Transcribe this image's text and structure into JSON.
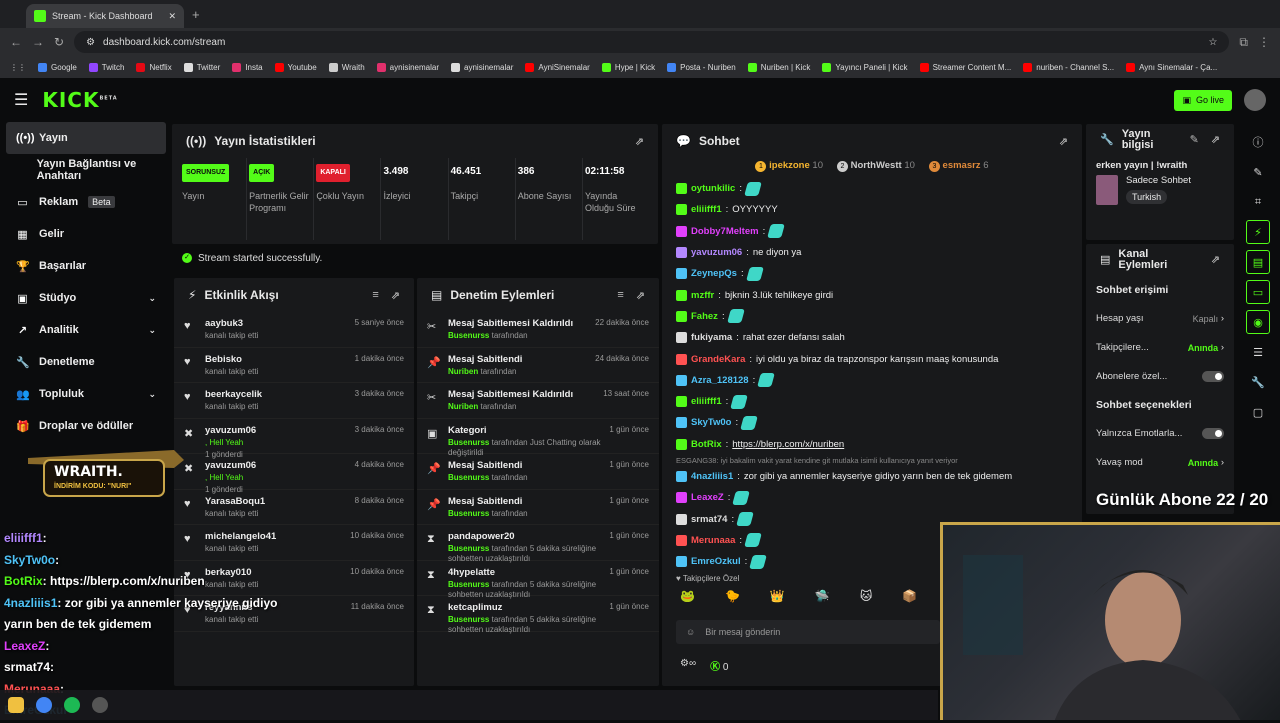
{
  "browser": {
    "tab_title": "Stream - Kick Dashboard",
    "url": "dashboard.kick.com/stream",
    "bookmarks": [
      {
        "label": "Google",
        "color": "#4285f4"
      },
      {
        "label": "Twitch",
        "color": "#9146ff"
      },
      {
        "label": "Netflix",
        "color": "#e50914"
      },
      {
        "label": "Twitter",
        "color": "#dddddd"
      },
      {
        "label": "Insta",
        "color": "#e1306c"
      },
      {
        "label": "Youtube",
        "color": "#ff0000"
      },
      {
        "label": "Wraith",
        "color": "#cccccc"
      },
      {
        "label": "aynisinemalar",
        "color": "#e1306c"
      },
      {
        "label": "aynisinemalar",
        "color": "#dddddd"
      },
      {
        "label": "AyniSinemalar",
        "color": "#ff0000"
      },
      {
        "label": "Hype | Kick",
        "color": "#53fc18"
      },
      {
        "label": "Posta - Nuriben",
        "color": "#4285f4"
      },
      {
        "label": "Nuriben | Kick",
        "color": "#53fc18"
      },
      {
        "label": "Yayıncı Paneli | Kick",
        "color": "#53fc18"
      },
      {
        "label": "Streamer Content M...",
        "color": "#ff0000"
      },
      {
        "label": "nuriben - Channel S...",
        "color": "#ff0000"
      },
      {
        "label": "Aynı Sinemalar - Ça...",
        "color": "#ff0000"
      }
    ]
  },
  "header": {
    "logo": "KICK",
    "logo_sup": "BETA",
    "go_live": "Go live"
  },
  "sidebar": [
    {
      "label": "Yayın",
      "icon": "((•))",
      "active": true
    },
    {
      "label": "Yayın Bağlantısı ve Anahtarı",
      "icon": ""
    },
    {
      "label": "Reklam",
      "icon": "▭",
      "badge": "Beta"
    },
    {
      "label": "Gelir",
      "icon": "▦"
    },
    {
      "label": "Başarılar",
      "icon": "🏆"
    },
    {
      "label": "Stüdyo",
      "icon": "▣",
      "chev": "⌄"
    },
    {
      "label": "Analitik",
      "icon": "↗",
      "chev": "⌄"
    },
    {
      "label": "Denetleme",
      "icon": "🔧"
    },
    {
      "label": "Topluluk",
      "icon": "👥",
      "chev": "⌄"
    },
    {
      "label": "Droplar ve ödüller",
      "icon": "🎁"
    }
  ],
  "stats": {
    "title": "Yayın İstatistikleri",
    "cols": [
      {
        "pill": "SORUNSUZ",
        "pill_color": "#53fc18",
        "label": "Yayın"
      },
      {
        "pill": "AÇIK",
        "pill_color": "#53fc18",
        "label": "Partnerlik Gelir Programı"
      },
      {
        "pill": "KAPALI",
        "pill_color": "#e0202e",
        "label": "Çoklu Yayın"
      },
      {
        "num": "3.498",
        "label": "İzleyici"
      },
      {
        "num": "46.451",
        "label": "Takipçi"
      },
      {
        "num": "386",
        "label": "Abone Sayısı"
      },
      {
        "num": "02:11:58",
        "label": "Yayında Olduğu Süre"
      }
    ],
    "ok": "Stream started successfully."
  },
  "activity": {
    "title": "Etkinlik Akışı",
    "rows": [
      {
        "icon": "♥",
        "name": "aaybuk3",
        "desc": "kanalı takip etti",
        "time": "5 saniye önce"
      },
      {
        "icon": "♥",
        "name": "Bebisko",
        "desc": "kanalı takip etti",
        "time": "1 dakika önce"
      },
      {
        "icon": "♥",
        "name": "beerkaycelik",
        "desc": "kanalı takip etti",
        "time": "3 dakika önce"
      },
      {
        "icon": "✖",
        "name": "yavuzum06",
        "desc": ", Hell Yeah",
        "extra": "1 gönderdi",
        "time": "3 dakika önce"
      },
      {
        "icon": "✖",
        "name": "yavuzum06",
        "desc": ", Hell Yeah",
        "extra": "1 gönderdi",
        "time": "4 dakika önce"
      },
      {
        "icon": "♥",
        "name": "YarasaBoqu1",
        "desc": "kanalı takip etti",
        "time": "8 dakika önce"
      },
      {
        "icon": "♥",
        "name": "michelangelo41",
        "desc": "kanalı takip etti",
        "time": "10 dakika önce"
      },
      {
        "icon": "♥",
        "name": "berkay010",
        "desc": "kanalı takip etti",
        "time": "10 dakika önce"
      },
      {
        "icon": "♥",
        "name": "reyyannns",
        "desc": "kanalı takip etti",
        "time": "11 dakika önce"
      }
    ]
  },
  "mod": {
    "title": "Denetim Eylemleri",
    "rows": [
      {
        "icon": "✂",
        "name": "Mesaj Sabitlemesi Kaldırıldı",
        "by": "Busenurss",
        "desc": "tarafından",
        "time": "22 dakika önce"
      },
      {
        "icon": "📌",
        "name": "Mesaj Sabitlendi",
        "by": "Nuriben",
        "desc": "tarafından",
        "time": "24 dakika önce"
      },
      {
        "icon": "✂",
        "name": "Mesaj Sabitlemesi Kaldırıldı",
        "by": "Nuriben",
        "desc": "tarafından",
        "time": "13 saat önce"
      },
      {
        "icon": "▣",
        "name": "Kategori",
        "by": "Busenurss",
        "desc": "tarafından Just Chatting olarak değiştirildi",
        "time": "1 gün önce"
      },
      {
        "icon": "📌",
        "name": "Mesaj Sabitlendi",
        "by": "Busenurss",
        "desc": "tarafından",
        "time": "1 gün önce"
      },
      {
        "icon": "📌",
        "name": "Mesaj Sabitlendi",
        "by": "Busenurss",
        "desc": "tarafından",
        "time": "1 gün önce"
      },
      {
        "icon": "⧗",
        "name": "pandapower20",
        "by": "Busenurss",
        "desc": "tarafından 5 dakika süreliğine sohbetten uzaklaştırıldı",
        "time": "1 gün önce"
      },
      {
        "icon": "⧗",
        "name": "4hypelatte",
        "by": "Busenurss",
        "desc": "tarafından 5 dakika süreliğine sohbetten uzaklaştırıldı",
        "time": "1 gün önce"
      },
      {
        "icon": "⧗",
        "name": "ketcaplimuz",
        "by": "Busenurss",
        "desc": "tarafından 5 dakika süreliğine sohbetten uzaklaştırıldı",
        "time": "1 gün önce"
      }
    ]
  },
  "chat": {
    "title": "Sohbet",
    "top": [
      {
        "rank": "1",
        "name": "ipekzone",
        "n": "10",
        "color": "#f5b530"
      },
      {
        "rank": "2",
        "name": "NorthWestt",
        "n": "10",
        "color": "#cccccc"
      },
      {
        "rank": "3",
        "name": "esmasrz",
        "n": "6",
        "color": "#e08a3a"
      }
    ],
    "lines": [
      {
        "user": "oytunkilic",
        "color": "#53fc18",
        "text": ""
      },
      {
        "user": "eliiifff1",
        "color": "#53fc18",
        "text": "OYYYYYY"
      },
      {
        "user": "Dobby7Meltem",
        "color": "#e040fb",
        "text": ""
      },
      {
        "user": "yavuzum06",
        "color": "#b388ff",
        "text": "ne diyon ya"
      },
      {
        "user": "ZeynepQs",
        "color": "#4fc3f7",
        "text": ""
      },
      {
        "user": "mzffr",
        "color": "#53fc18",
        "text": "bjknin 3.lük tehlikeye girdi"
      },
      {
        "user": "Fahez",
        "color": "#53fc18",
        "text": ""
      },
      {
        "user": "fukiyama",
        "color": "#dddddd",
        "text": "rahat ezer defansı salah"
      },
      {
        "user": "GrandeKara",
        "color": "#ff5252",
        "text": "iyi oldu ya biraz da trapzonspor karışsın maaş konusunda"
      },
      {
        "user": "Azra_128128",
        "color": "#4fc3f7",
        "text": ""
      },
      {
        "user": "eliiifff1",
        "color": "#53fc18",
        "text": ""
      },
      {
        "user": "SkyTw0o",
        "color": "#4fc3f7",
        "text": ""
      },
      {
        "user": "BotRix",
        "color": "#53fc18",
        "text": "https://blerp.com/x/nuriben"
      },
      {
        "user": "4nazliiis1",
        "color": "#4fc3f7",
        "text": "zor gibi ya annemler kayseriye gidiyo yarın ben de tek gidemem"
      },
      {
        "user": "LeaxeZ",
        "color": "#e040fb",
        "text": ""
      },
      {
        "user": "srmat74",
        "color": "#dddddd",
        "text": ""
      },
      {
        "user": "Merunaaa",
        "color": "#ff5252",
        "text": ""
      },
      {
        "user": "EmreOzkul",
        "color": "#4fc3f7",
        "text": ""
      }
    ],
    "reply": "ESGANG38: iyi bakalim vakit yarat kendine git mutlaka isimli kullanıcıya yanıt veriyor",
    "followers_only": "Takipçilere Özel",
    "placeholder": "Bir mesaj gönderin",
    "count": "0"
  },
  "info": {
    "title": "Yayın bilgisi",
    "stream_title": "erken yayın | !wraith",
    "category": "Sadece Sohbet",
    "tag": "Turkish"
  },
  "channel": {
    "title": "Kanal Eylemleri",
    "s1": "Sohbet erişimi",
    "age": "Hesap yaşı",
    "age_v": "Kapalı",
    "fol": "Takipçilere...",
    "fol_v": "Anında",
    "sub": "Abonelere özel...",
    "s2": "Sohbet seçenekleri",
    "emote": "Yalnızca Emotlarla...",
    "slow": "Yavaş mod",
    "slow_v": "Anında"
  },
  "overlay": {
    "sponsor": "WRAITH.",
    "code": "İNDİRİM KODU: \"NURI\"",
    "goal": "Günlük Abone 22 / 20",
    "lines": [
      {
        "u": "eliiifff1",
        "c": "#b388ff",
        "t": ":"
      },
      {
        "u": "SkyTw0o",
        "c": "#4fc3f7",
        "t": ":"
      },
      {
        "u": "BotRix",
        "c": "#53fc18",
        "t": ": https://blerp.com/x/nuriben"
      },
      {
        "u": "4nazliiis1",
        "c": "#4fc3f7",
        "t": ": zor gibi ya annemler kayseriye gidiyo"
      },
      {
        "u": "",
        "c": "#fff",
        "t": "yarın ben de tek gidemem"
      },
      {
        "u": "LeaxeZ",
        "c": "#e040fb",
        "t": ":"
      },
      {
        "u": "srmat74",
        "c": "#fff",
        "t": ":"
      },
      {
        "u": "Merunaaa",
        "c": "#ff5252",
        "t": ":"
      },
      {
        "u": "EmreOzkul",
        "c": "#4fc3f7",
        "t": ""
      }
    ]
  }
}
